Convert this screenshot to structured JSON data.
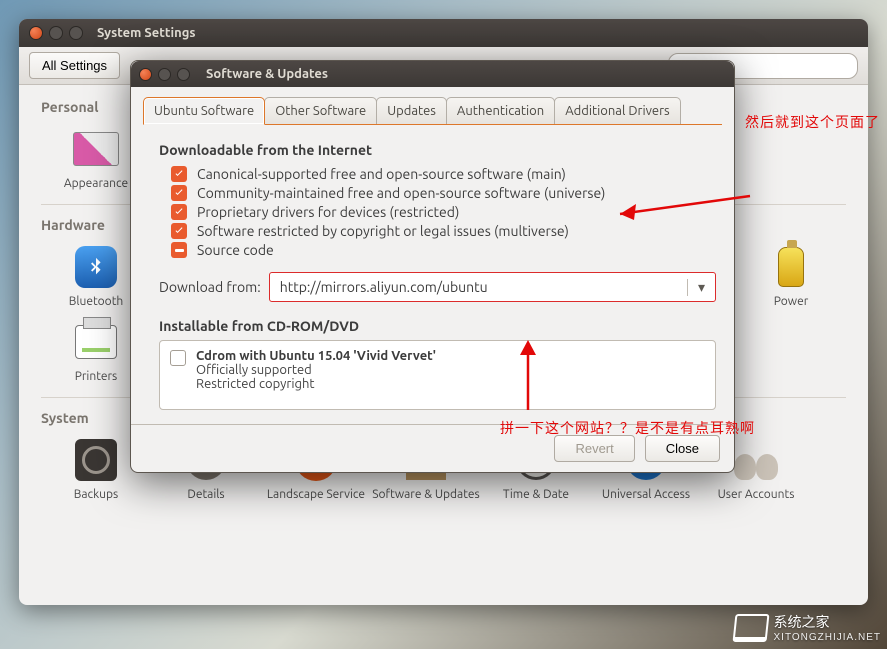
{
  "settings_window": {
    "title": "System Settings",
    "toolbar": {
      "all_settings": "All Settings"
    },
    "sections": {
      "personal": {
        "title": "Personal",
        "items": [
          "Appearance"
        ]
      },
      "hardware": {
        "title": "Hardware",
        "items": [
          "Bluetooth",
          "Printers",
          "Power"
        ]
      },
      "system": {
        "title": "System",
        "items": [
          "Backups",
          "Details",
          "Landscape Service",
          "Software & Updates",
          "Time & Date",
          "Universal Access",
          "User Accounts"
        ]
      }
    }
  },
  "dialog": {
    "title": "Software & Updates",
    "tabs": [
      "Ubuntu Software",
      "Other Software",
      "Updates",
      "Authentication",
      "Additional Drivers"
    ],
    "active_tab_index": 0,
    "group1_title": "Downloadable from the Internet",
    "check_items": [
      {
        "checked": true,
        "label": "Canonical-supported free and open-source software (main)"
      },
      {
        "checked": true,
        "label": "Community-maintained free and open-source software (universe)"
      },
      {
        "checked": true,
        "label": "Proprietary drivers for devices (restricted)"
      },
      {
        "checked": true,
        "label": "Software restricted by copyright or legal issues (multiverse)"
      },
      {
        "checked": "dash",
        "label": "Source code"
      }
    ],
    "download_label": "Download from:",
    "download_value": "http://mirrors.aliyun.com/ubuntu",
    "group2_title": "Installable from CD-ROM/DVD",
    "cd": {
      "checked": false,
      "line1": "Cdrom with Ubuntu 15.04 'Vivid Vervet'",
      "line2": "Officially supported",
      "line3": "Restricted copyright"
    },
    "buttons": {
      "revert": "Revert",
      "close": "Close"
    }
  },
  "annotations": {
    "a1": "然后就到这个页面了",
    "a2": "拼一下这个网站？？是不是有点耳熟啊"
  },
  "watermark": {
    "line1": "系统之家",
    "line2": "XITONGZHIJIA.NET"
  }
}
